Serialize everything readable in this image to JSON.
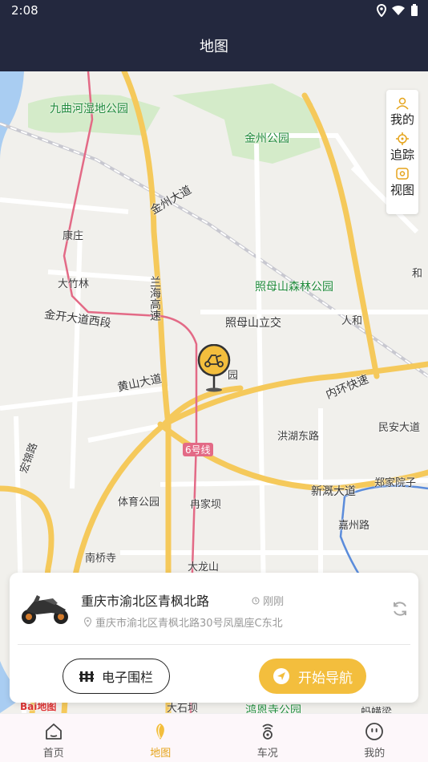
{
  "status_bar": {
    "time": "2:08"
  },
  "header": {
    "title": "地图"
  },
  "map": {
    "labels": {
      "jiuqu": "九曲河湿地公园",
      "jinzhou_park": "金州公园",
      "jinzhou_ave": "金州大道",
      "kangzhuang": "康庄",
      "dazhulin": "大竹林",
      "lanhai": "兰海高速",
      "jinkai": "金开大道西段",
      "zhaomushan_park": "照母山森林公园",
      "zhaomushan_jct": "照母山立交",
      "renhe": "人和",
      "he": "和",
      "huangshan": "黄山大道",
      "garden": "园",
      "neihuan": "内环快速",
      "minan": "民安大道",
      "honghu": "洪湖东路",
      "line6": "6号线",
      "hongjin": "宏锦路",
      "zhengjia": "郑家院子",
      "xinxi": "新溉大道",
      "tiyu": "体育公园",
      "ranjiaba": "冉家坝",
      "jiazhou": "嘉州路",
      "nanqiao": "南桥寺",
      "dalongshan": "大龙山",
      "dashiba": "大石坝",
      "hongen": "鸿恩寺公园",
      "mahuangliang": "蚂蟥梁",
      "baidu": "Bai地图"
    }
  },
  "map_tools": {
    "mine": "我的",
    "track": "追踪",
    "view": "视图"
  },
  "vehicle_card": {
    "title": "重庆市渝北区青枫北路",
    "time": "刚刚",
    "address": "重庆市渝北区青枫北路30号凤凰座C东北",
    "fence_label": "电子围栏",
    "nav_label": "开始导航"
  },
  "tabbar": {
    "home": "首页",
    "map": "地图",
    "status": "车况",
    "mine": "我的"
  },
  "colors": {
    "header_bg": "#23283e",
    "accent": "#f3be3d",
    "highway": "#f5c95b",
    "metro": "#e36a86"
  }
}
